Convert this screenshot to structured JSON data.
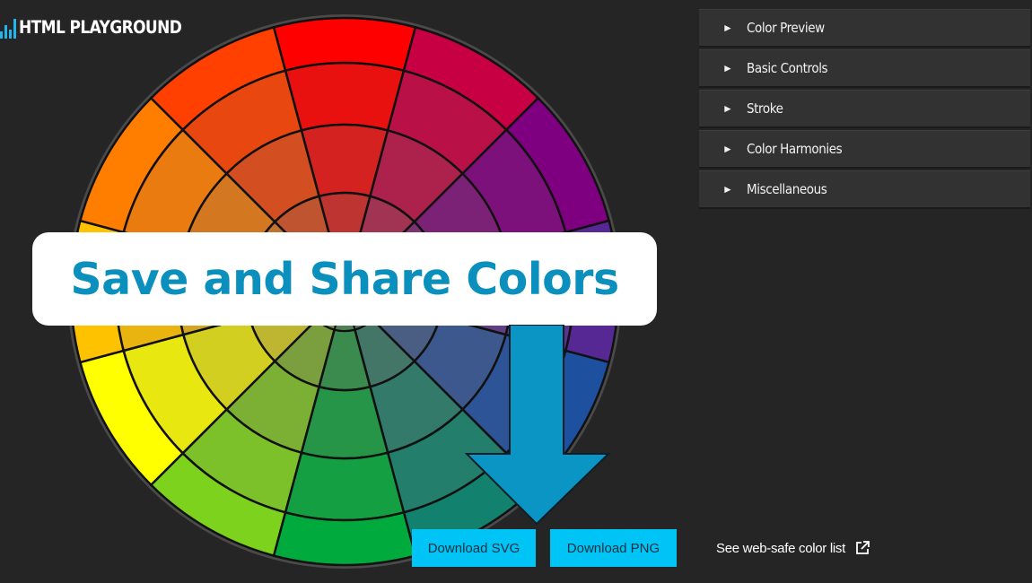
{
  "logo": {
    "text": "HTML PLAYGROUND"
  },
  "accordion": {
    "items": [
      {
        "arrow": "►",
        "label": "Color Preview"
      },
      {
        "arrow": "►",
        "label": "Basic Controls"
      },
      {
        "arrow": "►",
        "label": "Stroke"
      },
      {
        "arrow": "►",
        "label": "Color Harmonies"
      },
      {
        "arrow": "►",
        "label": "Miscellaneous"
      }
    ]
  },
  "websafe_link": {
    "label": "See web-safe color list",
    "icon": "external-link-icon"
  },
  "banner": {
    "text": "Save and Share Colors"
  },
  "buttons": {
    "download_svg": "Download SVG",
    "download_png": "Download PNG"
  },
  "colors": {
    "accent": "#00c4f5",
    "banner_text": "#0b8fbc",
    "arrow": "#0a95c4",
    "panel_bg": "#323232",
    "page_bg": "#252525"
  },
  "color_wheel": {
    "segments": 12,
    "rings": 5,
    "hues_clockwise_from_top": [
      "red",
      "red-violet",
      "violet",
      "blue-violet",
      "blue",
      "blue-green",
      "green",
      "yellow-green",
      "yellow",
      "yellow-orange",
      "orange",
      "red-orange"
    ]
  }
}
